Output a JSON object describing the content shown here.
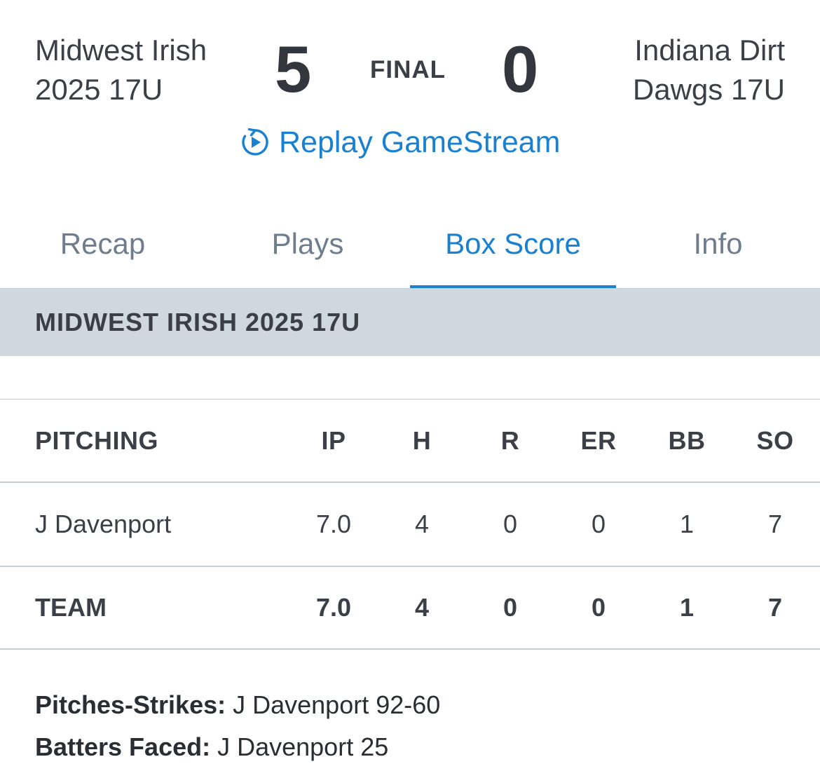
{
  "game": {
    "away_team": "Midwest Irish\n2025 17U",
    "away_score": "5",
    "status": "FINAL",
    "home_score": "0",
    "home_team": "Indiana Dirt\nDawgs 17U",
    "replay_label": "Replay GameStream"
  },
  "tabs": [
    {
      "label": "Recap"
    },
    {
      "label": "Plays"
    },
    {
      "label": "Box Score"
    },
    {
      "label": "Info"
    }
  ],
  "team_banner": "MIDWEST IRISH 2025 17U",
  "pitching": {
    "columns": [
      "PITCHING",
      "IP",
      "H",
      "R",
      "ER",
      "BB",
      "SO"
    ],
    "rows": [
      {
        "name": "J Davenport",
        "ip": "7.0",
        "h": "4",
        "r": "0",
        "er": "0",
        "bb": "1",
        "so": "7"
      }
    ],
    "team": {
      "name": "TEAM",
      "ip": "7.0",
      "h": "4",
      "r": "0",
      "er": "0",
      "bb": "1",
      "so": "7"
    }
  },
  "notes": {
    "pitches_label": "Pitches-Strikes:",
    "pitches_value": " J Davenport 92-60",
    "batters_label": "Batters Faced:",
    "batters_value": " J Davenport 25"
  },
  "colors": {
    "accent": "#1a80d0",
    "banner_bg": "#cfd8df",
    "tab_inactive": "#6f7d8c"
  },
  "icons": {
    "replay": "replay-circle-play-icon"
  }
}
